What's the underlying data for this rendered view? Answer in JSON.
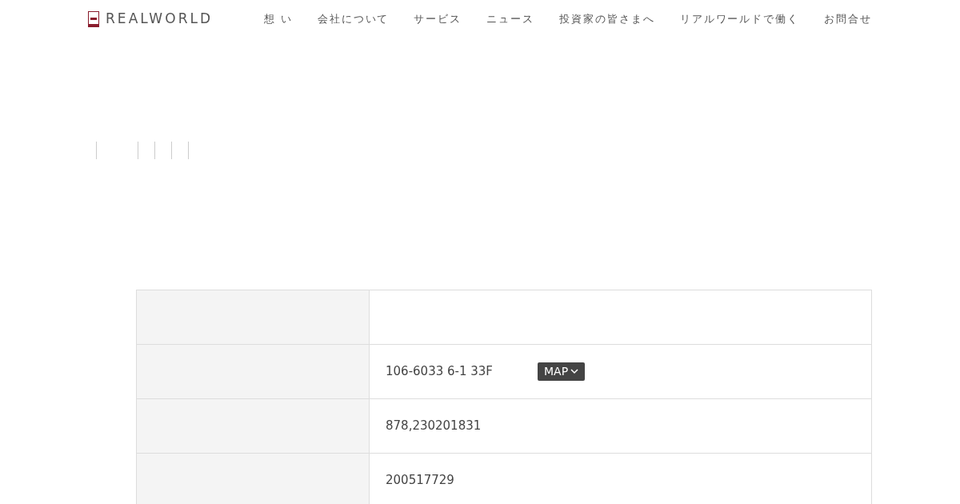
{
  "header": {
    "logo_text": "REALWORLD",
    "nav": [
      "想 い",
      "会社について",
      "サービス",
      "ニュース",
      "投資家の皆さまへ",
      "リアルワールドで働く",
      "お問合せ"
    ]
  },
  "table": {
    "rows": [
      {
        "value": ""
      },
      {
        "value": "106-6033 6-1 33F",
        "button": "MAP"
      },
      {
        "value": "878,230201831"
      },
      {
        "value": "200517729"
      }
    ]
  }
}
